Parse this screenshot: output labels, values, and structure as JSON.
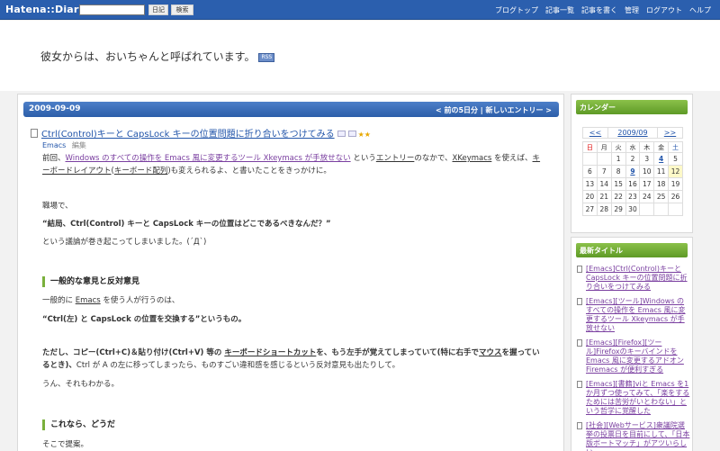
{
  "topbar": {
    "logo": "Hatena::Diary",
    "search_placeholder": "",
    "diary_button": "日記",
    "search_button": "検索",
    "links": [
      "ブログトップ",
      "記事一覧",
      "記事を書く",
      "管理",
      "ログアウト",
      "ヘルプ"
    ]
  },
  "header": {
    "title": "彼女からは、おいちゃんと呼ばれています。",
    "rss": "RSS"
  },
  "datebar": {
    "date": "2009-09-09",
    "nav": "< 前の5日分  |  新しいエントリー >"
  },
  "entry": {
    "title": "Ctrl(Control)キーと CapsLock キーの位置問題に折り合いをつけてみる",
    "category": "Emacs",
    "edit": "編集",
    "p1_a": "前回、",
    "p1_link": "Windows のすべての操作を Emacs 風に変更するツール Xkeymacs が手放せない",
    "p1_b": " という",
    "p1_c": "エントリー",
    "p1_d": "のなかで、",
    "p1_e": "XKeymacs",
    "p1_f": " を使えば、",
    "p1_g": "キーボードレイアウト",
    "p1_h": "(",
    "p1_i": "キーボード配列",
    "p1_j": ")も変えられるよ、と書いたことをきっかけに。",
    "p2": "職場で、",
    "p3": "“結局、Ctrl(Control) キーと CapsLock キーの位置はどこであるべきなんだ？”",
    "p4": "という議論が巻き起こってしまいました。(´Д`)",
    "h1": "一般的な意見と反対意見",
    "p5_a": "一般的に ",
    "p5_b": "Emacs",
    "p5_c": " を使う人が行うのは、",
    "p6": "“Ctrl(左) と CapsLock の位置を交換する”というもの。",
    "p7_a": "ただし、コピー(Ctrl+C)＆貼り付け(Ctrl+V) 等の ",
    "p7_b": "キーボードショートカット",
    "p7_c": "を、もう左手が覚えてしまっていて(特に右手で",
    "p7_d": "マウス",
    "p7_e": "を握っているとき)、",
    "p7_f": "Ctrl が A の左に移ってしまったら、ものすごい違和感を感じるという反対意見も出たりして。",
    "p8": "うん、それもわかる。",
    "h2": "これなら、どうだ",
    "p9": "そこで提案。"
  },
  "calendar": {
    "heading": "カレンダー",
    "prev": "<<",
    "month": "2009/09",
    "next": ">>",
    "dow": [
      "日",
      "月",
      "火",
      "水",
      "木",
      "金",
      "土"
    ],
    "weeks": [
      [
        "",
        "",
        "1",
        "2",
        "3",
        "4",
        "5"
      ],
      [
        "6",
        "7",
        "8",
        "9",
        "10",
        "11",
        "12"
      ],
      [
        "13",
        "14",
        "15",
        "16",
        "17",
        "18",
        "19"
      ],
      [
        "20",
        "21",
        "22",
        "23",
        "24",
        "25",
        "26"
      ],
      [
        "27",
        "28",
        "29",
        "30",
        "",
        "",
        ""
      ]
    ]
  },
  "recent": {
    "heading": "最新タイトル",
    "items": [
      "[Emacs]Ctrl(Control)キーと CapsLock キーの位置問題に折り合いをつけてみる",
      "[Emacs][ツール]Windows のすべての操作を Emacs 風に変更するツール Xkeymacs が手放せない",
      "[Emacs][Firefox][ツール]Firefoxのキーバインドを Emacs 風に変更するアドオン Firemacs が便利すぎる",
      "[Emacs][書籍]viと Emacs を1か月ずつ使ってみて、「楽をするためには苦労がいとわない」という哲学に覚醒した",
      "[社会][Webサービス]衆議院選挙の投票日を目前にして、「日本版ボートマッチ」がアツいらしい"
    ]
  }
}
